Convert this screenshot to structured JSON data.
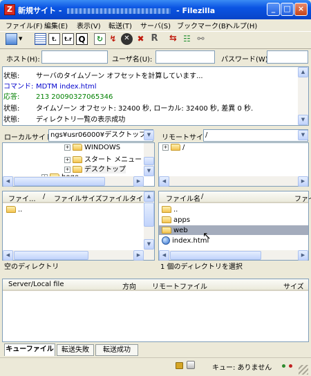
{
  "window": {
    "title_prefix": "新規サイト - ",
    "title_suffix": " - Filezilla",
    "app_icon": "Z",
    "min_label": "_",
    "max_label": "□",
    "close_label": "×"
  },
  "menu": [
    "ファイル(F)",
    "編集(E)",
    "表示(V)",
    "転送(T)",
    "サーバ(S)",
    "ブックマーク(B)",
    "ヘルプ(H)"
  ],
  "toolbar": {
    "icons": [
      "site-manager-icon",
      "toggle-log-icon",
      "toggle-local-tree-icon",
      "toggle-remote-tree-icon",
      "toggle-queue-icon",
      "refresh-icon",
      "process-queue-icon",
      "cancel-icon",
      "disconnect-icon",
      "reconnect-icon",
      "filter-icon",
      "compare-icon",
      "sync-browse-icon"
    ],
    "reconnect_label": "R"
  },
  "quickconnect": {
    "host_label": "ホスト(H):",
    "user_label": "ユーザ名(U):",
    "pass_label": "パスワード(W):"
  },
  "log": [
    {
      "type": "状態:",
      "msg": "サーバのタイムゾーン オフセットを計算しています..."
    },
    {
      "type": "コマンド:",
      "msg": "MDTM index.html"
    },
    {
      "type": "応答:",
      "msg": "213 20090327065346"
    },
    {
      "type": "状態:",
      "msg": "タイムゾーン オフセット: 32400 秒, ローカル: 32400 秒, 差異 0 秒."
    },
    {
      "type": "状態:",
      "msg": "ディレクトリ一覧の表示成功"
    }
  ],
  "colors": {
    "command": "#0000cc",
    "response": "#008000",
    "accent": "#0a54e3"
  },
  "local": {
    "site_label": "ローカルサイト:",
    "path": "ngs¥usr06000¥デスクトップ",
    "tree": [
      "WINDOWS",
      "スタート メニュー",
      "デスクトップ",
      "hoge"
    ],
    "headers": [
      "ファイ...",
      "/",
      "ファイルサイズ",
      "ファイルタイプ"
    ],
    "files": [
      ".."
    ],
    "status": "空のディレクトリ"
  },
  "remote": {
    "site_label": "リモートサイト:",
    "path": "/",
    "tree_root": "/",
    "headers": [
      "ファイル名",
      "/",
      "ファイ"
    ],
    "files": [
      "..",
      "apps",
      "web",
      "index.html"
    ],
    "selected": "web",
    "status": "1 個のディレクトリを選択"
  },
  "queue": {
    "headers": [
      "Server/Local file",
      "方向",
      "リモートファイル",
      "サイズ"
    ],
    "tabs": [
      "キューファイル",
      "転送失敗",
      "転送成功"
    ],
    "status": "キュー: ありません"
  }
}
